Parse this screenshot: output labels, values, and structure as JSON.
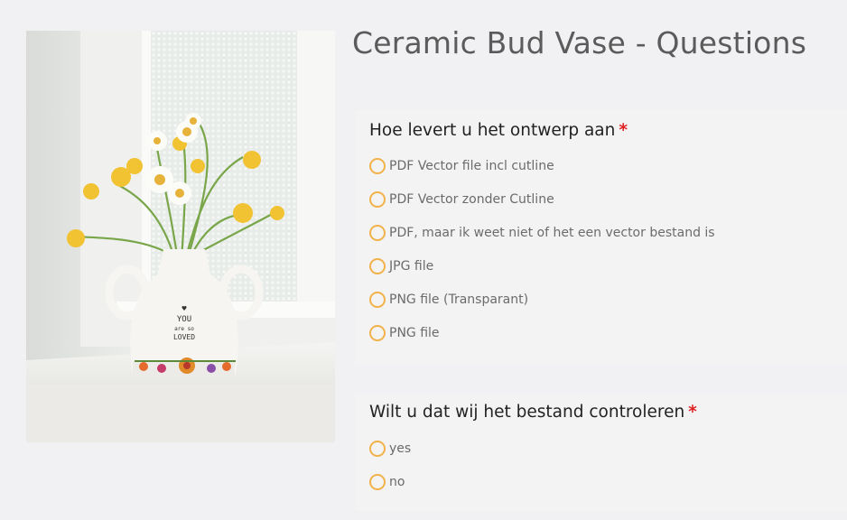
{
  "page": {
    "title": "Ceramic Bud Vase - Questions"
  },
  "photo": {
    "vase_text_line1": "YOU",
    "vase_text_line2": "are so",
    "vase_text_line3": "LOVED"
  },
  "questions": [
    {
      "label": "Hoe levert u het ontwerp aan",
      "required_mark": "*",
      "options": [
        "PDF Vector file incl cutline",
        "PDF Vector zonder Cutline",
        "PDF, maar ik weet niet of het een vector bestand is",
        "JPG file",
        "PNG file (Transparant)",
        "PNG file"
      ]
    },
    {
      "label": "Wilt u dat wij het bestand controleren",
      "required_mark": "*",
      "options": [
        "yes",
        "no"
      ]
    }
  ],
  "colors": {
    "radio_border": "#f2b24a",
    "required": "#e02020",
    "title": "#5b5b5b"
  }
}
